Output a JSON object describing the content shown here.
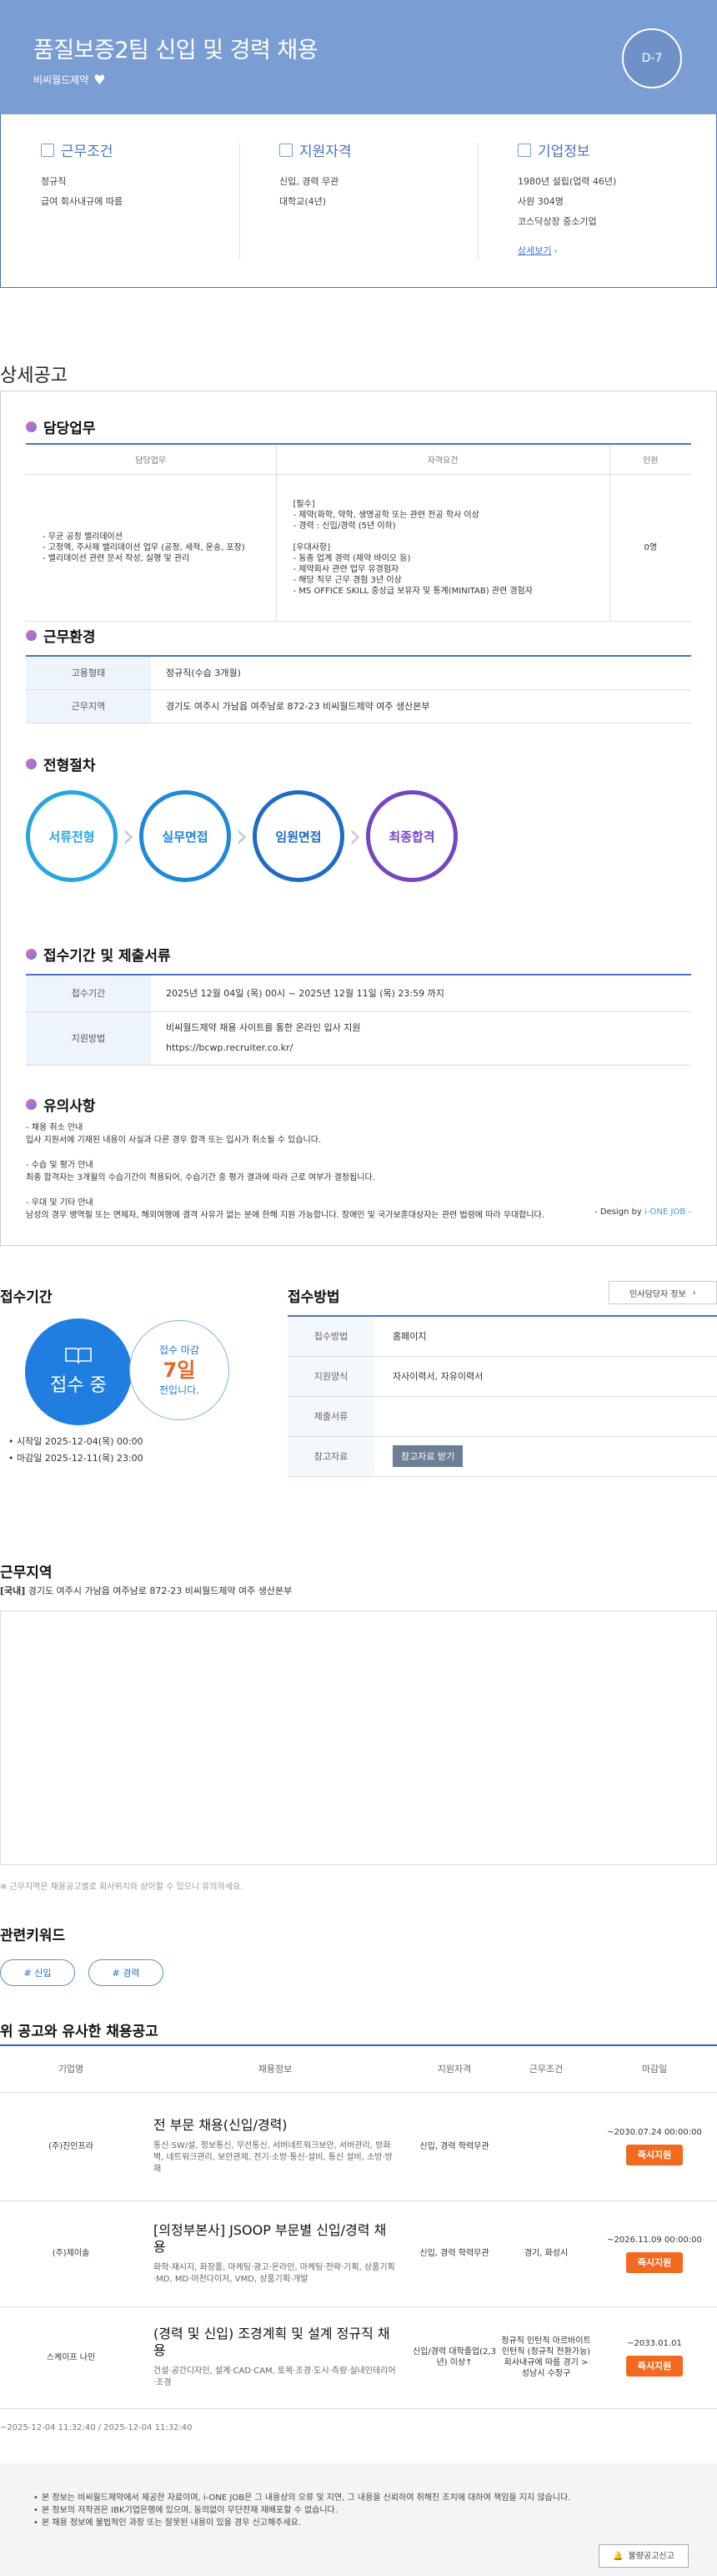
{
  "header": {
    "title": "품질보증2팀 신입 및 경력 채용",
    "company": "비씨월드제약",
    "dday": "D-7"
  },
  "summary": [
    {
      "title": "근무조건",
      "lines": [
        "정규직",
        "급여 회사내규에 따름"
      ]
    },
    {
      "title": "지원자격",
      "lines": [
        "신입, 경력 무관",
        "대학교(4년)"
      ]
    },
    {
      "title": "기업정보",
      "lines": [
        "1980년 설립(업력 46년)",
        "사원 304명",
        "코스닥상장 중소기업"
      ],
      "link": "상세보기"
    }
  ],
  "detail": {
    "section_title": "상세공고",
    "duty": {
      "title": "담당업무",
      "headers": [
        "담당업무",
        "자격요건",
        "인원"
      ],
      "work": [
        "- 무균 공정 밸리데이션",
        "- 고정액, 주사제 밸리데이션 업무 (공정, 세척, 운송, 포장)",
        "- 밸리데이션 관련 문서 작성, 실행 및 관리"
      ],
      "req": [
        "[필수]",
        "- 제약(화학, 약학, 생명공학 또는 관련 전공 학사 이상",
        "- 경력 : 신입/경력 (5년 이하)",
        "",
        "[우대사항]",
        "- 동종 업계 경력 (제약 바이오 등)",
        "- 제약회사 관련 업무 유경험자",
        "- 해당 직무 근무 경험 3년 이상",
        "- MS OFFICE SKILL 중상급 보유자 및 통계(MINITAB) 관련 경험자"
      ],
      "count": "0명"
    },
    "env": {
      "title": "근무환경",
      "rows": [
        {
          "k": "고용형태",
          "v": "정규직(수습 3개월)"
        },
        {
          "k": "근무지역",
          "v": "경기도 여주시 가남읍 여주남로 872-23 비씨월드제약 여주 생산본부"
        }
      ]
    },
    "process": {
      "title": "전형절차",
      "steps": [
        "서류전형",
        "실무면접",
        "임원면접",
        "최종합격"
      ],
      "colors": [
        "#27a6df",
        "#1f88d9",
        "#1e6bc7",
        "#7447c1"
      ]
    },
    "period": {
      "title": "접수기간 및 제출서류",
      "rows": [
        {
          "k": "접수기간",
          "v": [
            "2025년 12월 04일 (목) 00시 ~ 2025년 12월 11일 (목) 23:59 까지"
          ]
        },
        {
          "k": "지원방법",
          "v": [
            "비씨월드제약 채용 사이트를 통한 온라인 입사 지원",
            "https://bcwp.recruiter.co.kr/"
          ]
        }
      ]
    },
    "notice": {
      "title": "유의사항",
      "lines": [
        "- 채용 취소 안내",
        "입사 지원서에 기재된 내용이 사실과 다른 경우 합격 또는 입사가 취소될 수 있습니다.",
        "",
        "- 수습 및 평가 안내",
        "최종 합격자는 3개월의 수습기간이 적용되어, 수습기간 중 평가 결과에 따라 근로 여부가 결정됩니다.",
        "",
        "- 우대 및 기타 안내",
        "남성의 경우 병역필 또는 면제자, 해외여행에 결격 사유가 없는 분에 한해 지원 가능합니다. 장애인 및 국가보훈대상자는 관련 법령에 따라 우대합니다."
      ]
    },
    "design_prefix": "- Design by ",
    "design_brand": "i-ONE JOB -"
  },
  "apply": {
    "title": "접수기간",
    "status": "접수 중",
    "remain_prefix": "접수 마감",
    "remain_days": "7일",
    "remain_suffix": "전입니다.",
    "start": "시작일 2025-12-04(목) 00:00",
    "end": "마감일 2025-12-11(목) 23:00"
  },
  "method": {
    "title": "접수방법",
    "contact_btn": "인사담당자 정보",
    "rows": [
      {
        "k": "접수방법",
        "v": "홈페이지"
      },
      {
        "k": "지원양식",
        "v": "자사이력서, 자유이력서"
      },
      {
        "k": "제출서류",
        "v": ""
      }
    ],
    "ref_label": "참고자료",
    "ref_btn": "참고자료 받기"
  },
  "location": {
    "title": "근무지역",
    "tag": "[국내]",
    "addr": "경기도 여주시 가남읍 여주남로 872-23 비씨월드제약 여주 생산본부",
    "note": "※ 근무지역은 채용공고별로 회사위치와 상이할 수 있으니 유의하세요."
  },
  "keywords": {
    "title": "관련키워드",
    "items": [
      "# 신입",
      "# 경력"
    ]
  },
  "similar": {
    "title": "위 공고와 유사한 채용공고",
    "headers": [
      "기업명",
      "채용정보",
      "지원자격",
      "근무조건",
      "마감일"
    ],
    "rows": [
      {
        "company": "(주)진인프라",
        "title": "전 부문 채용(신입/경력)",
        "desc": "통신·SW/설, 정보통신, 무선통신, 서버네트워크보안, 서버관리, 방화벽, 네트워크관리, 보안관제, 전기·소방·통신·설비, 통신 설비, 소방·방재",
        "qual": "신입, 경력 학력무관",
        "cond": "",
        "deadline": "~2030.07.24 00:00:00",
        "btn": "즉시지원"
      },
      {
        "company": "(주)제이솔",
        "title": "[의정부본사] JSOOP 부문별 신입/경력 채용",
        "desc": "화학·재시지, 화장품, 마케팅·광고·온라인, 마케팅·전략·기획, 상품기획·MD, MD·머천다이저, VMD, 상품기획·개발",
        "qual": "신입, 경력 학력무관",
        "cond": "경기, 화성시",
        "deadline": "~2026.11.09 00:00:00",
        "btn": "즉시지원"
      },
      {
        "company": "스케이프 나인",
        "title": "(경력 및 신입) 조경계획 및 설계 정규직 채용",
        "desc": "건설·공간디자인, 설계·CAD·CAM, 토목·조경·도시·측량·실내인테리어·조경",
        "qual": "신입/경력 대학졸업(2,3년) 이상↑",
        "cond": "정규직 인턴직 아르바이트 인턴직 (정규직 전환가능) 회사내규에 따름 경기 > 성남시 수정구",
        "deadline": "~2033.01.01",
        "btn": "즉시지원"
      }
    ]
  },
  "footer": {
    "dates": "~2025-12-04 11:32:40 / 2025-12-04 11:32:40",
    "lines": [
      "본 정보는 비씨월드제약에서 제공한 자료이며, i-ONE JOB은 그 내용상의 오류 및 지연, 그 내용을 신뢰하여 취해진 조치에 대하여 책임을 지지 않습니다.",
      "본 정보의 저작권은 IBK기업은행에 있으며, 동의없이 무단전재 재배포할 수 없습니다.",
      "본 채용 정보에 불법적인 과장 또는 잘못된 내용이 있을 경우 신고해주세요."
    ],
    "report": "불량공고신고"
  }
}
